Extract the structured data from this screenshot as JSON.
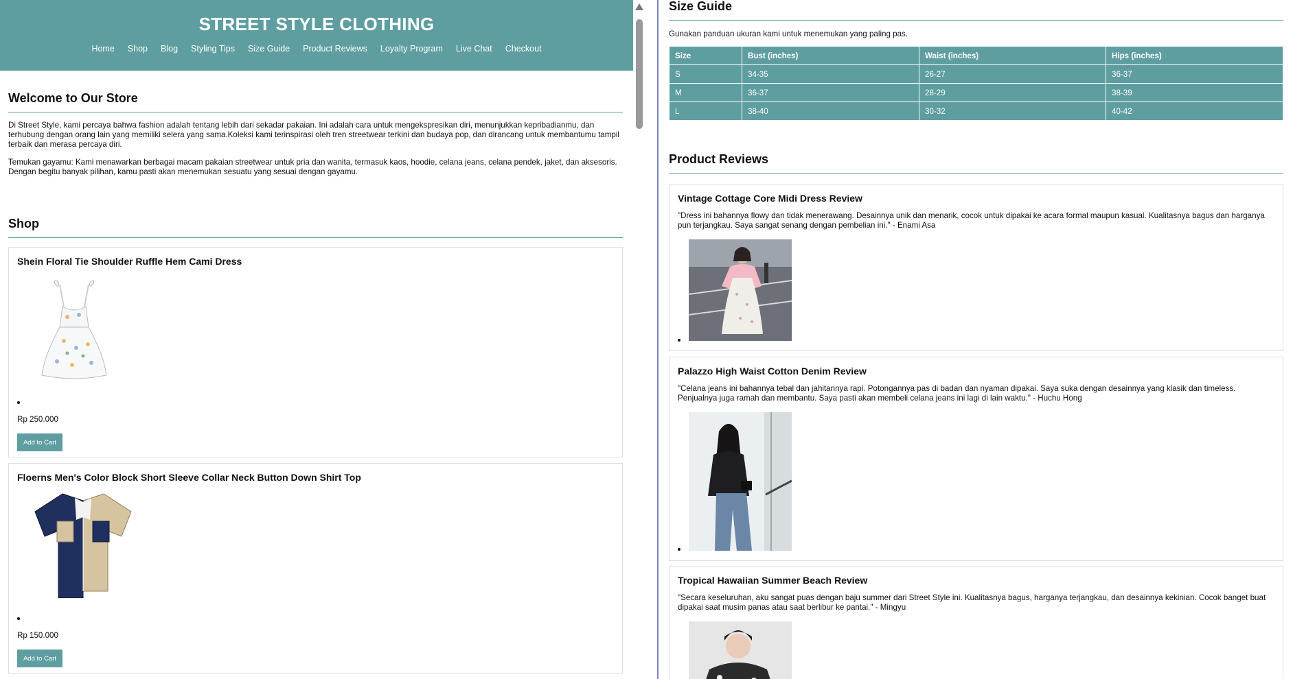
{
  "header": {
    "title": "STREET STYLE CLOTHING",
    "nav": [
      "Home",
      "Shop",
      "Blog",
      "Styling Tips",
      "Size Guide",
      "Product Reviews",
      "Loyalty Program",
      "Live Chat",
      "Checkout"
    ]
  },
  "welcome": {
    "heading": "Welcome to Our Store",
    "paragraph_1": "Di Street Style, kami percaya bahwa fashion adalah tentang lebih dari sekadar pakaian. Ini adalah cara untuk mengekspresikan diri, menunjukkan kepribadianmu, dan terhubung dengan orang lain yang memiliki selera yang sama.Koleksi kami terinspirasi oleh tren streetwear terkini dan budaya pop, dan dirancang untuk membantumu tampil terbaik dan merasa percaya diri.",
    "paragraph_2": "Temukan gayamu: Kami menawarkan berbagai macam pakaian streetwear untuk pria dan wanita, termasuk kaos, hoodie, celana jeans, celana pendek, jaket, dan aksesoris. Dengan begitu banyak pilihan, kamu pasti akan menemukan sesuatu yang sesuai dengan gayamu."
  },
  "shop": {
    "heading": "Shop",
    "products": [
      {
        "name": "Shein Floral Tie Shoulder Ruffle Hem Cami Dress",
        "price": "Rp 250.000",
        "button": "Add to Cart"
      },
      {
        "name": "Floerns Men's Color Block Short Sleeve Collar Neck Button Down Shirt Top",
        "price": "Rp 150.000",
        "button": "Add to Cart"
      }
    ]
  },
  "size_guide": {
    "heading": "Size Guide",
    "intro": "Gunakan panduan ukuran kami untuk menemukan yang paling pas.",
    "columns": [
      "Size",
      "Bust (inches)",
      "Waist (inches)",
      "Hips (inches)"
    ],
    "rows": [
      [
        "S",
        "34-35",
        "26-27",
        "36-37"
      ],
      [
        "M",
        "36-37",
        "28-29",
        "38-39"
      ],
      [
        "L",
        "38-40",
        "30-32",
        "40-42"
      ]
    ]
  },
  "reviews": {
    "heading": "Product Reviews",
    "items": [
      {
        "title": "Vintage Cottage Core Midi Dress Review",
        "text": "\"Dress ini bahannya flowy dan tidak menerawang. Desainnya unik dan menarik, cocok untuk dipakai ke acara formal maupun kasual. Kualitasnya bagus dan harganya pun terjangkau. Saya sangat senang dengan pembelian ini.\" - Enami Asa"
      },
      {
        "title": "Palazzo High Waist Cotton Denim Review",
        "text": "\"Celana jeans ini bahannya tebal dan jahitannya rapi. Potongannya pas di badan dan nyaman dipakai. Saya suka dengan desainnya yang klasik dan timeless. Penjualnya juga ramah dan membantu. Saya pasti akan membeli celana jeans ini lagi di lain waktu.\" - Huchu Hong"
      },
      {
        "title": "Tropical Hawaiian Summer Beach Review",
        "text": "\"Secara keseluruhan, aku sangat puas dengan baju summer dari Street Style ini. Kualitasnya bagus, harganya terjangkau, dan desainnya kekinian. Cocok banget buat dipakai saat musim panas atau saat berlibur ke pantai.\" - Mingyu"
      }
    ]
  },
  "colors": {
    "accent": "#5f9ea0",
    "divider": "#3d4f9f"
  }
}
